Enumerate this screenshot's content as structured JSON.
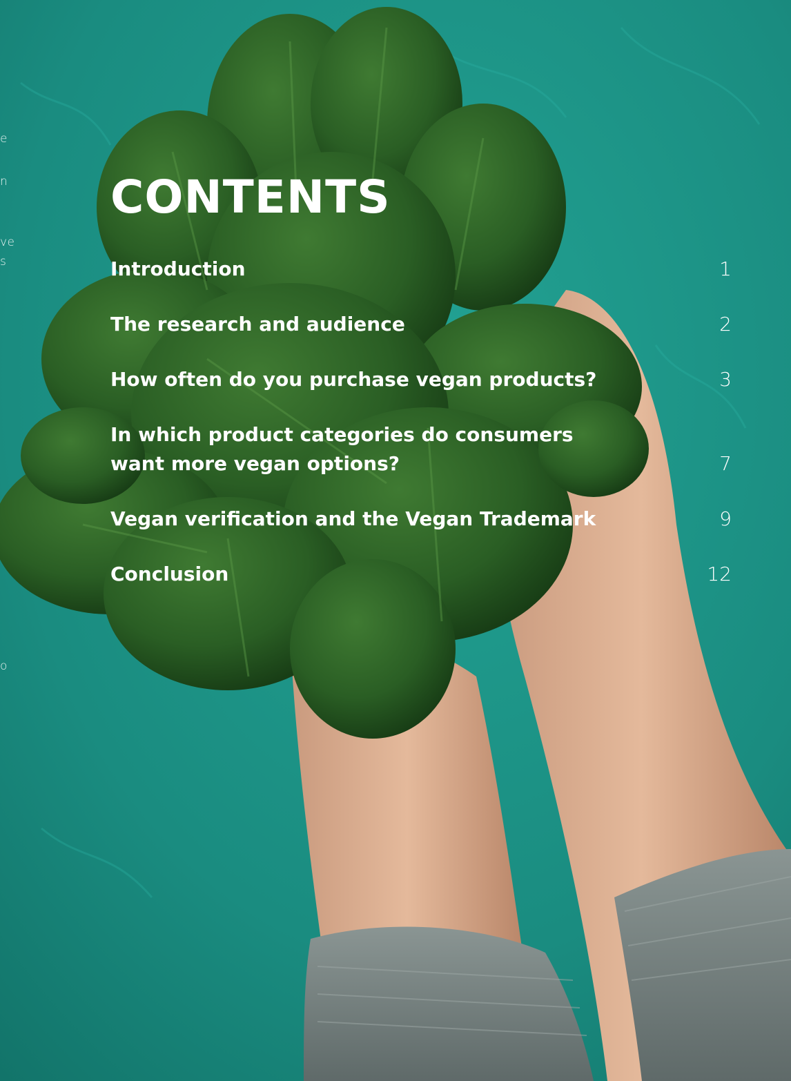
{
  "page": {
    "heading": "CONTENTS",
    "background_color": "#1b8a7f"
  },
  "edge_fragments": [
    "e",
    "n",
    "ve",
    "s",
    "o"
  ],
  "toc": [
    {
      "label": "Introduction",
      "page": "1"
    },
    {
      "label": "The research and audience",
      "page": "2"
    },
    {
      "label": "How often do you purchase vegan products?",
      "page": "3"
    },
    {
      "label": "In which product categories do consumers want more vegan options?",
      "page": "7"
    },
    {
      "label": "Vegan verification and the Vegan Trademark",
      "page": "9"
    },
    {
      "label": "Conclusion",
      "page": "12"
    }
  ],
  "photo": {
    "subject": "hands holding a bunch of spinach leaves",
    "icon": "spinach-photo"
  }
}
